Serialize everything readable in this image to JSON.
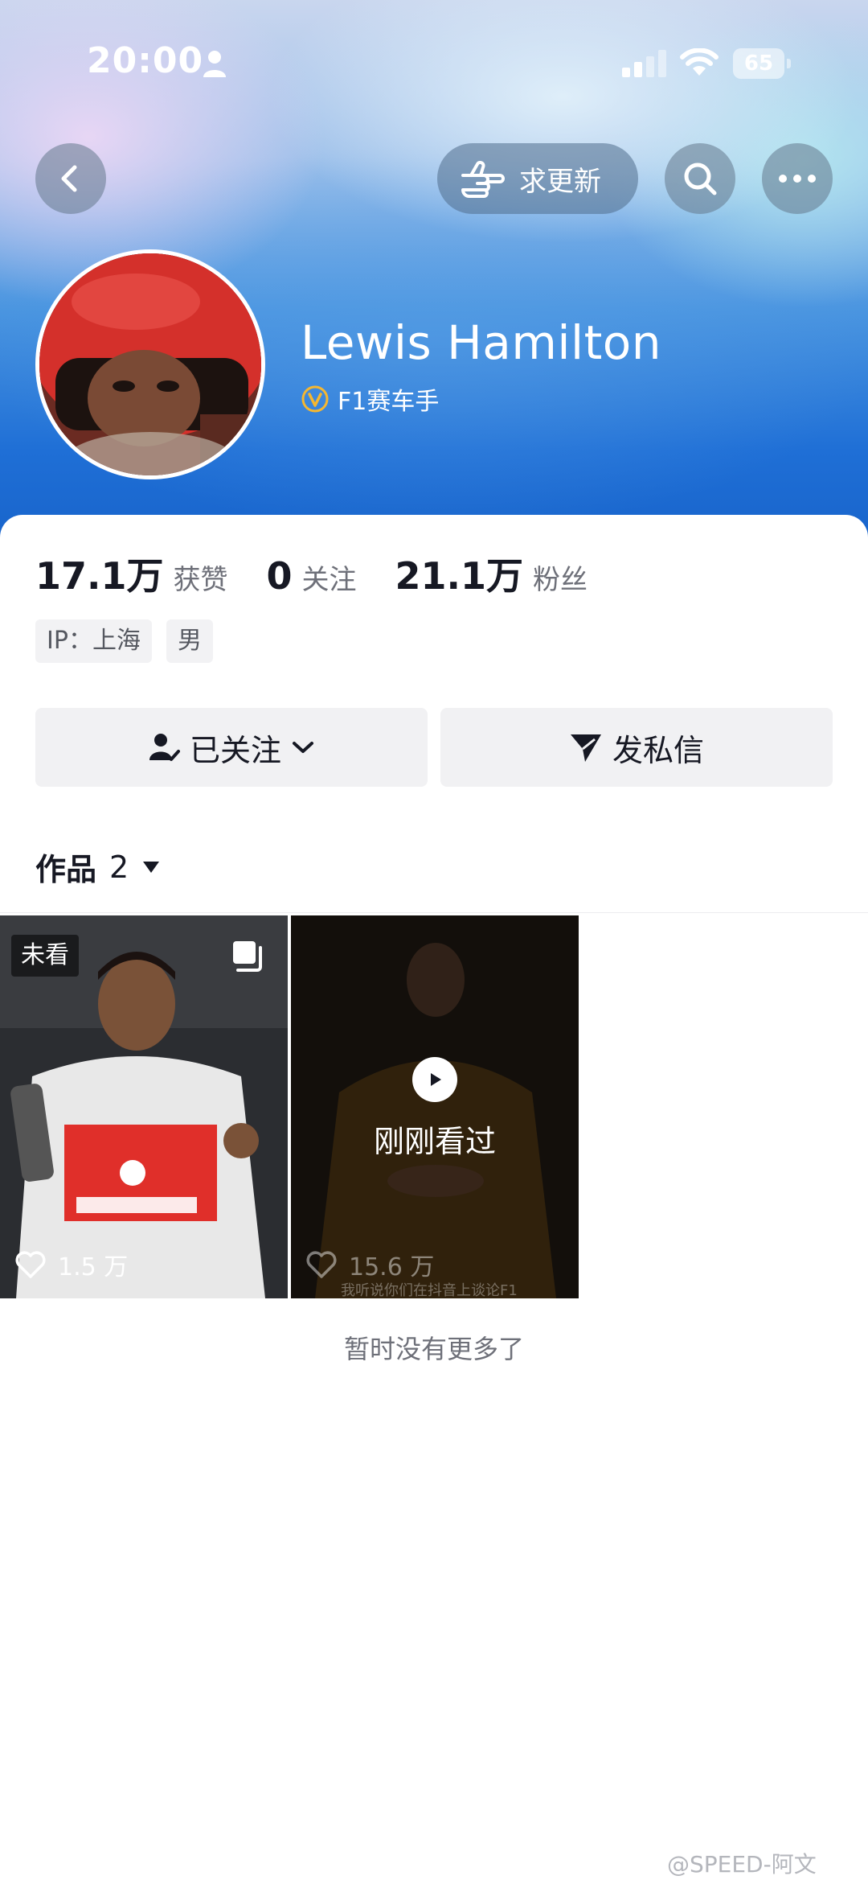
{
  "status_bar": {
    "time": "20:00",
    "battery": "65"
  },
  "nav": {
    "update_label": "求更新"
  },
  "profile": {
    "name": "Lewis Hamilton",
    "verification": "F1赛车手"
  },
  "stats": [
    {
      "value": "17.1万",
      "label": "获赞"
    },
    {
      "value": "0",
      "label": "关注"
    },
    {
      "value": "21.1万",
      "label": "粉丝"
    }
  ],
  "tags": [
    "IP：上海",
    "男"
  ],
  "actions": {
    "followed": "已关注",
    "message": "发私信"
  },
  "works": {
    "title": "作品",
    "count": "2"
  },
  "videos": [
    {
      "badge": "未看",
      "likes": "1.5 万"
    },
    {
      "overlay": "刚刚看过",
      "likes": "15.6 万",
      "caption": "我听说你们在抖音上谈论F1"
    }
  ],
  "footer": {
    "no_more": "暂时没有更多了",
    "watermark": "@SPEED-阿文"
  },
  "colors": {
    "primary_text": "#161823",
    "secondary_text": "#6e7079",
    "button_bg": "#f1f1f3",
    "verify_gold": "#f5b731"
  }
}
